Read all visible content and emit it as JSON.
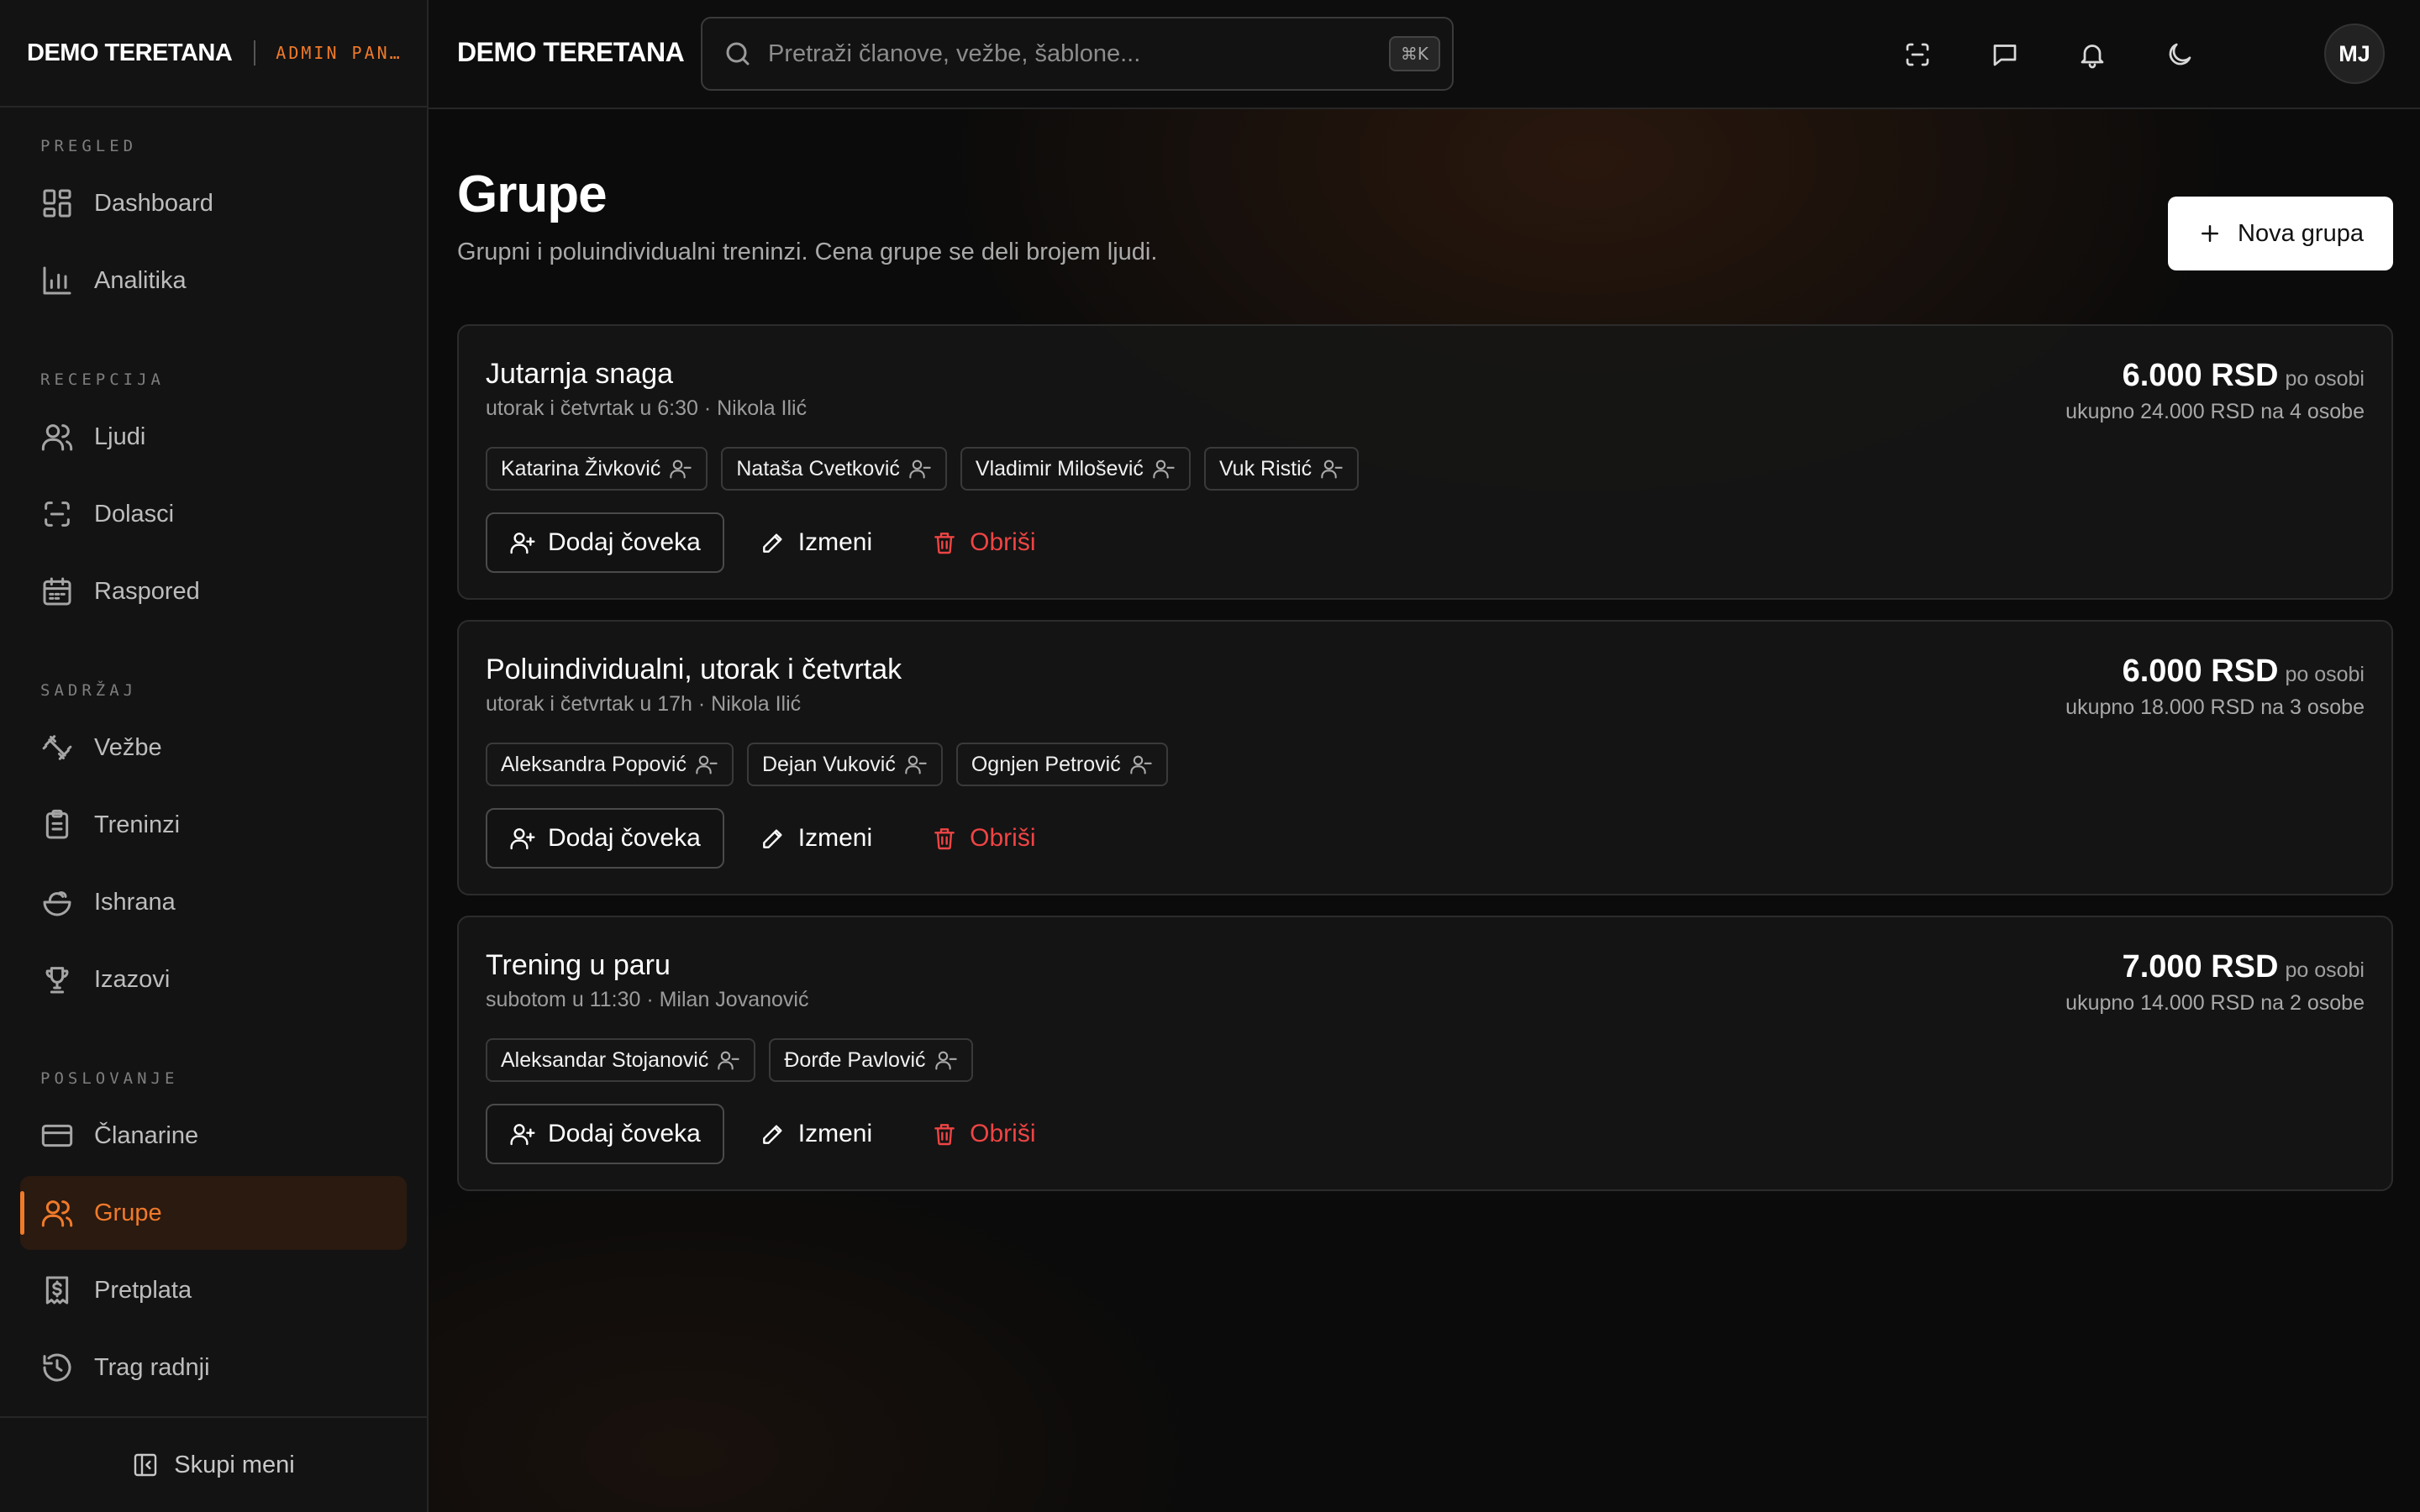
{
  "sidebar": {
    "brand_name": "DEMO TERETANA",
    "brand_sub": "ADMIN PAN…",
    "sections": [
      {
        "title": "PREGLED",
        "items": [
          {
            "label": "Dashboard",
            "icon": "dashboard-icon"
          },
          {
            "label": "Analitika",
            "icon": "bar-chart-icon"
          }
        ]
      },
      {
        "title": "RECEPCIJA",
        "items": [
          {
            "label": "Ljudi",
            "icon": "users-icon"
          },
          {
            "label": "Dolasci",
            "icon": "scan-icon"
          },
          {
            "label": "Raspored",
            "icon": "calendar-icon"
          }
        ]
      },
      {
        "title": "SADRŽAJ",
        "items": [
          {
            "label": "Vežbe",
            "icon": "dumbbell-icon"
          },
          {
            "label": "Treninzi",
            "icon": "clipboard-icon"
          },
          {
            "label": "Ishrana",
            "icon": "salad-icon"
          },
          {
            "label": "Izazovi",
            "icon": "trophy-icon"
          }
        ]
      },
      {
        "title": "POSLOVANJE",
        "items": [
          {
            "label": "Članarine",
            "icon": "credit-card-icon"
          },
          {
            "label": "Grupe",
            "icon": "users-icon",
            "active": true
          },
          {
            "label": "Pretplata",
            "icon": "receipt-dollar-icon"
          },
          {
            "label": "Trag radnji",
            "icon": "history-icon"
          }
        ]
      }
    ],
    "collapse_label": "Skupi meni"
  },
  "topbar": {
    "brand": "DEMO TERETANA",
    "search_placeholder": "Pretraži članove, vežbe, šablone...",
    "shortcut": "⌘K",
    "icons": [
      "scan-icon",
      "message-icon",
      "bell-icon",
      "moon-icon"
    ],
    "avatar_initials": "MJ"
  },
  "page": {
    "title": "Grupe",
    "subtitle": "Grupni i poluindividualni treninzi. Cena grupe se deli brojem ljudi.",
    "new_button": "Nova grupa"
  },
  "labels": {
    "add_person": "Dodaj čoveka",
    "edit": "Izmeni",
    "delete": "Obriši",
    "per_person": "po osobi"
  },
  "groups": [
    {
      "name": "Jutarnja snaga",
      "meta": "utorak i četvrtak u 6:30 · Nikola Ilić",
      "price": "6.000 RSD",
      "total": "ukupno 24.000 RSD na 4 osobe",
      "members": [
        "Katarina Živković",
        "Nataša Cvetković",
        "Vladimir Milošević",
        "Vuk Ristić"
      ]
    },
    {
      "name": "Poluindividualni, utorak i četvrtak",
      "meta": "utorak i četvrtak u 17h · Nikola Ilić",
      "price": "6.000 RSD",
      "total": "ukupno 18.000 RSD na 3 osobe",
      "members": [
        "Aleksandra Popović",
        "Dejan Vuković",
        "Ognjen Petrović"
      ]
    },
    {
      "name": "Trening u paru",
      "meta": "subotom u 11:30 · Milan Jovanović",
      "price": "7.000 RSD",
      "total": "ukupno 14.000 RSD na 2 osobe",
      "members": [
        "Aleksandar Stojanović",
        "Đorđe Pavlović"
      ]
    }
  ],
  "colors": {
    "accent": "#f07a2a",
    "danger": "#ef4444",
    "background": "#0b0b0b"
  }
}
